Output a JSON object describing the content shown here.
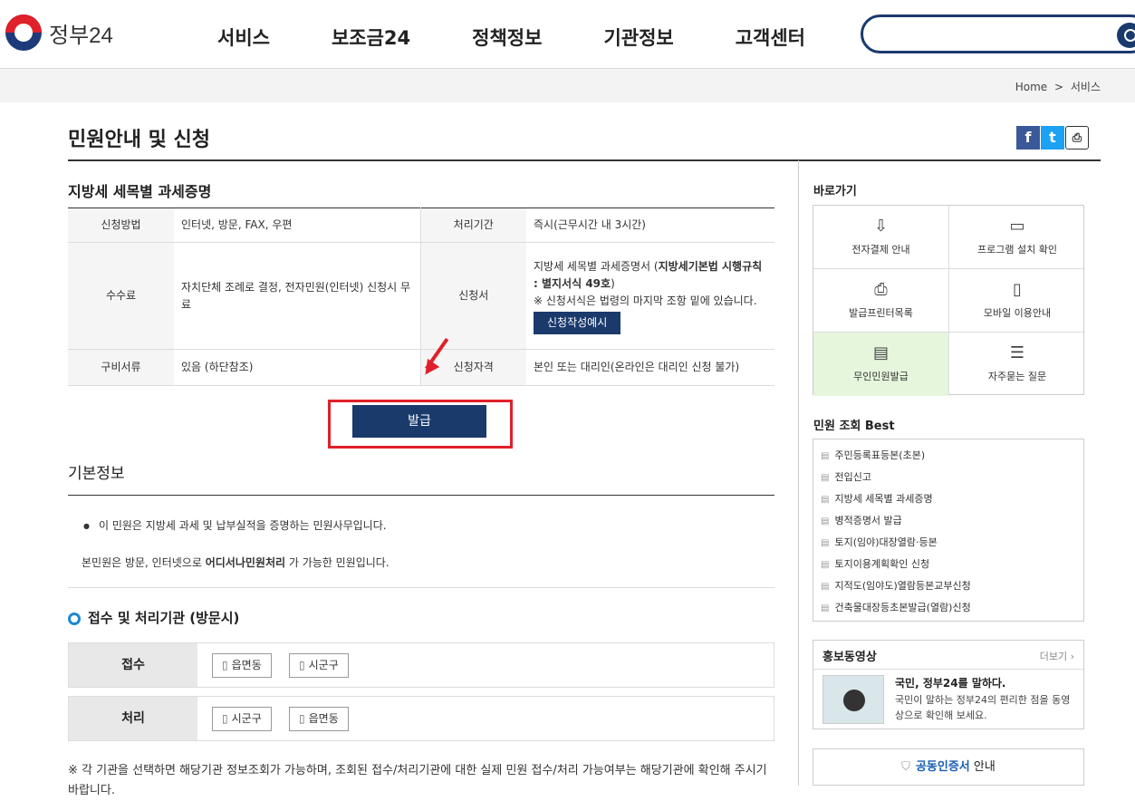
{
  "header": {
    "logo": "정부24",
    "nav": [
      "서비스",
      "보조금24",
      "정책정보",
      "기관정보",
      "고객센터"
    ],
    "search_placeholder": ""
  },
  "breadcrumb": {
    "home": "Home",
    "sep": ">",
    "current": "서비스"
  },
  "page_title": "민원안내 및 신청",
  "service": {
    "title": "지방세 세목별 과세증명",
    "rows": {
      "method_label": "신청방법",
      "method_value": "인터넷, 방문, FAX, 우편",
      "period_label": "처리기간",
      "period_value": "즉시(근무시간 내 3시간)",
      "fee_label": "수수료",
      "fee_value": "자치단체 조례로 결정, 전자민원(인터넷) 신청시 무료",
      "form_label": "신청서",
      "form_value_1": "지방세 세목별 과세증명서 (",
      "form_value_bold": "지방세기본법 시행규칙 : 별지서식 49호",
      "form_value_2": ")",
      "form_note": "※ 신청서식은 법령의 마지막 조항 밑에 있습니다.",
      "form_button": "신청작성예시",
      "docs_label": "구비서류",
      "docs_value": "있음 (하단참조)",
      "qual_label": "신청자격",
      "qual_value": "본인 또는 대리인(온라인은 대리인 신청 불가)"
    },
    "issue_button": "발급"
  },
  "basic": {
    "title": "기본정보",
    "bullet": "이 민원은 지방세 과세 및 납부실적을 증명하는 민원사무입니다.",
    "note_pre": "본민원은 방문, 인터넷으로 ",
    "note_bold": "어디서나민원처리",
    "note_post": " 가 가능한 민원입니다."
  },
  "agency": {
    "title": "접수 및 처리기관 (방문시)",
    "receive_label": "접수",
    "receive_chips": [
      "읍면동",
      "시군구"
    ],
    "process_label": "처리",
    "process_chips": [
      "시군구",
      "읍면동"
    ],
    "footnote": "※ 각 기관을 선택하면 해당기관 정보조회가 가능하며, 조회된 접수/처리기관에 대한 실제 민원 접수/처리 가능여부는 해당기관에 확인해 주시기 바랍니다."
  },
  "sidebar": {
    "quick_title": "바로가기",
    "quick": [
      "전자결제 안내",
      "프로그램 설치 확인",
      "발급프린터목록",
      "모바일 이용안내",
      "무인민원발급",
      "자주묻는 질문"
    ],
    "best_title": "민원 조회 Best",
    "best": [
      "주민등록표등본(초본)",
      "전입신고",
      "지방세 세목별 과세증명",
      "병적증명서 발급",
      "토지(임야)대장열람·등본",
      "토지이용계획확인 신청",
      "지적도(임야도)열람등본교부신청",
      "건축물대장등초본발급(열람)신청"
    ],
    "promo_title": "홍보동영상",
    "promo_more": "더보기 ›",
    "promo_video_title": "국민, 정부24를 말하다.",
    "promo_video_desc": "국민이 말하는 정부24의 편리한 점을 동영상으로 확인해 보세요.",
    "cert_blue": "공동인증서",
    "cert_rest": " 안내"
  },
  "colors": {
    "navy": "#1a3a6c",
    "highlight_red": "#e0202a",
    "active_green": "#e5f6dc"
  }
}
